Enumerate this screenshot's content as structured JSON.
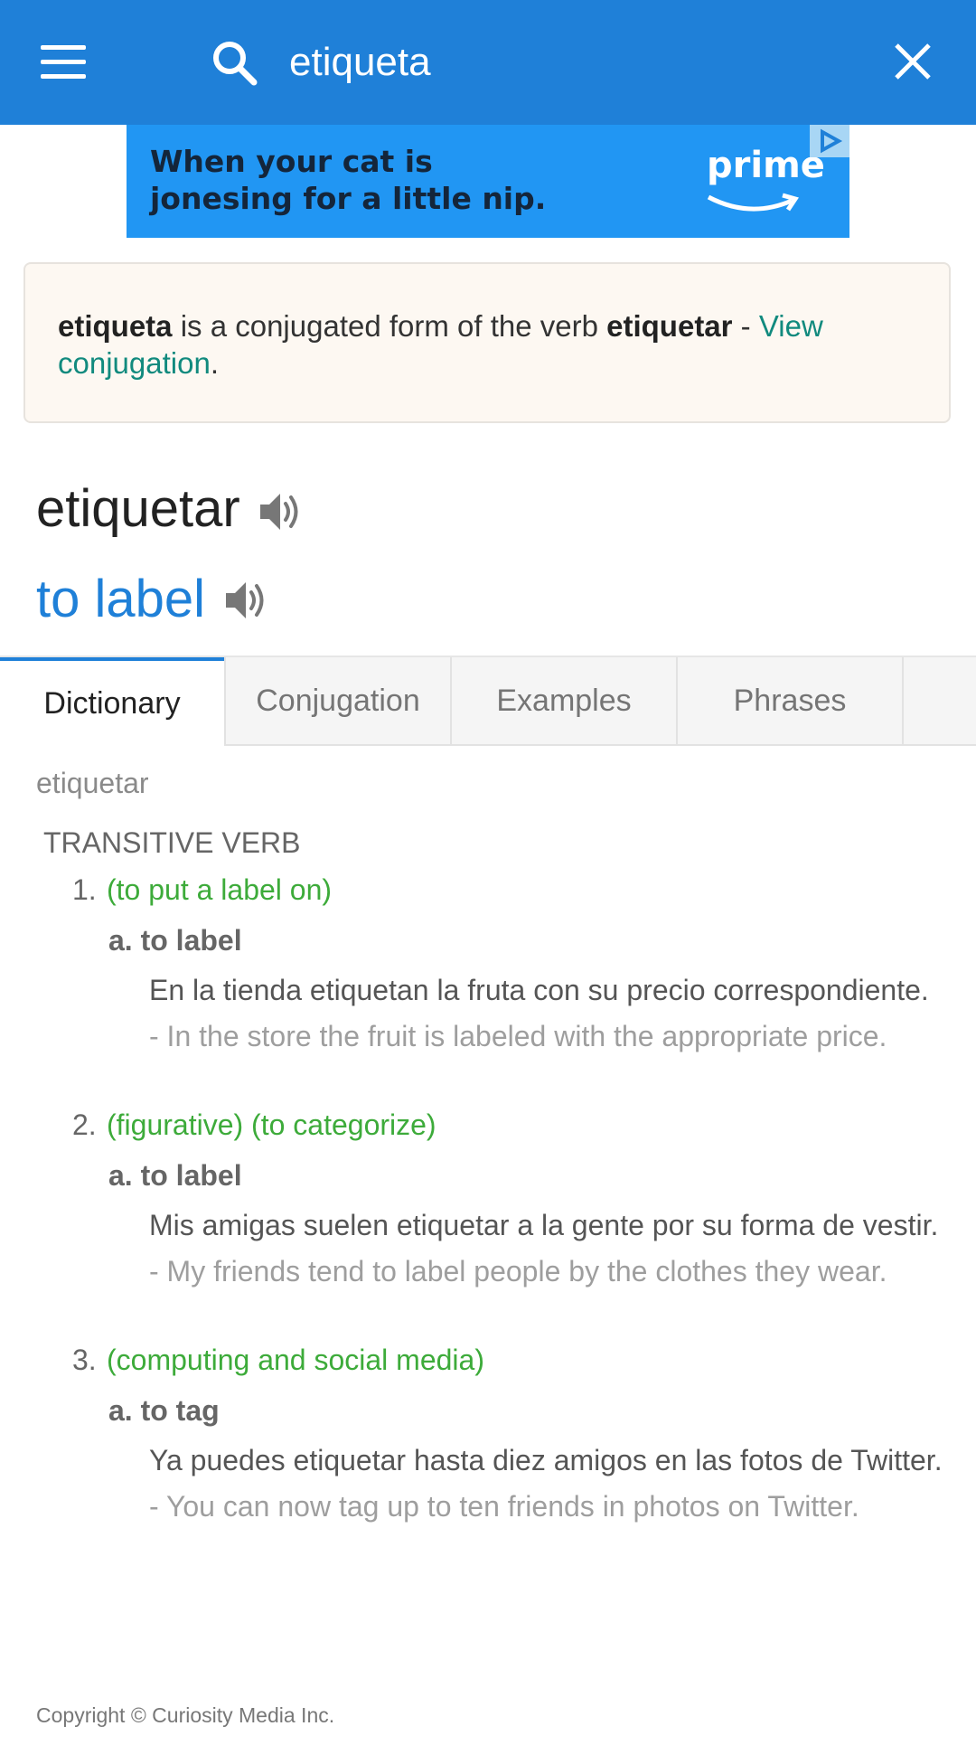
{
  "search": {
    "value": "etiqueta"
  },
  "ad": {
    "line1": "When your cat is",
    "line2": "jonesing for a little nip.",
    "brand": "prime"
  },
  "notice": {
    "word": "etiqueta",
    "middle": " is a conjugated form of the verb ",
    "verb": "etiquetar",
    "dash": " - ",
    "link": "View conjugation",
    "end": "."
  },
  "entry": {
    "headword": "etiquetar",
    "translation": "to label"
  },
  "tabs": [
    "Dictionary",
    "Conjugation",
    "Examples",
    "Phrases"
  ],
  "definition": {
    "word": "etiquetar",
    "pos": "TRANSITIVE VERB",
    "senses": [
      {
        "num": "1.",
        "context": "(to put a label on)",
        "sub": "a. to label",
        "example": "En la tienda etiquetan la fruta con su precio correspondiente.",
        "translation": " - In the store the fruit is labeled with the appropriate price."
      },
      {
        "num": "2.",
        "context": "(figurative) (to categorize)",
        "sub": "a. to label",
        "example": "Mis amigas suelen etiquetar a la gente por su forma de vestir.",
        "translation": " - My friends tend to label people by the clothes they wear."
      },
      {
        "num": "3.",
        "context": "(computing and social media)",
        "sub": "a. to tag",
        "example": "Ya puedes etiquetar hasta diez amigos en las fotos de Twitter.",
        "translation": " - You can now tag up to ten friends in photos on Twitter."
      }
    ]
  },
  "footer": {
    "copyright": "Copyright © Curiosity Media Inc."
  },
  "colors": {
    "header": "#1f80d8",
    "link": "#118a7e",
    "context": "#3dab3a",
    "notice_bg": "#fdf8f2"
  }
}
